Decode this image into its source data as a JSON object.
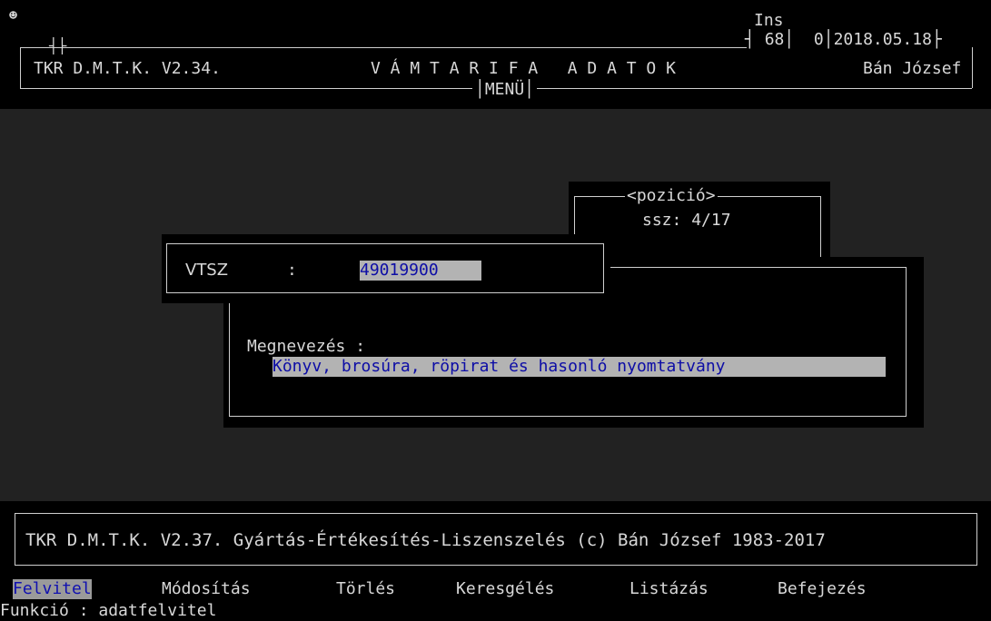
{
  "header": {
    "icon": "smiley-icon",
    "mode": "Ins",
    "counter_a": "68",
    "counter_b": "0",
    "date": "2018.05.18",
    "app_name": "TKR D.M.T.K. V2.34.",
    "title": "V Á M T A R I F A   A D A T O K",
    "user": "Bán József",
    "menu_label": "MENÜ"
  },
  "position_box": {
    "label": "<pozició>",
    "ssz_label": "ssz:",
    "ssz_value": "4/17"
  },
  "vtsz": {
    "label": "VTSZ",
    "separator": ":",
    "value": "49019900"
  },
  "description": {
    "label": "Megnevezés :",
    "value": "Könyv, brosúra, röpirat és hasonló nyomtatvány"
  },
  "footer": {
    "copyright": "TKR D.M.T.K. V2.37. Gyártás-Értékesítés-Liszenszelés (c) Bán József 1983-2017"
  },
  "menu": {
    "items": [
      "Felvitel",
      "Módosítás",
      "Törlés",
      "Keresgélés",
      "Listázás",
      "Befejezés"
    ],
    "selected": "Felvitel"
  },
  "function_line": "Funkció : adatfelvitel",
  "colors": {
    "background": "#000000",
    "work_area": "#222222",
    "text": "#d8d8d8",
    "field_bg": "#b3b3b3",
    "field_text": "#0d0da6"
  }
}
